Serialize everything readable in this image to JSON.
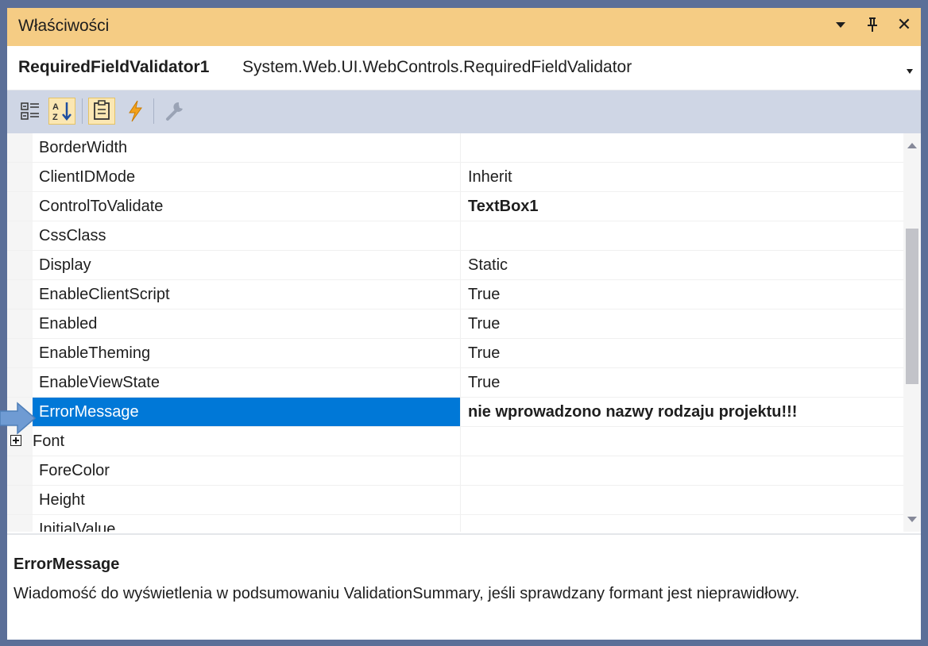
{
  "window": {
    "title": "Właściwości",
    "dropdown_icon": "caret-down-icon",
    "pin_icon": "pin-icon",
    "close_glyph": "✕"
  },
  "object_selector": {
    "name": "RequiredFieldValidator1",
    "type": "System.Web.UI.WebControls.RequiredFieldValidator"
  },
  "toolbar": {
    "buttons": [
      {
        "name": "categorized-icon",
        "active": false
      },
      {
        "name": "alphabetical-icon",
        "active": true
      },
      {
        "name": "properties-icon",
        "active": true
      },
      {
        "name": "events-icon",
        "active": false
      },
      {
        "name": "property-pages-icon",
        "active": false
      }
    ]
  },
  "properties": [
    {
      "name": "BorderWidth",
      "value": ""
    },
    {
      "name": "ClientIDMode",
      "value": "Inherit"
    },
    {
      "name": "ControlToValidate",
      "value": "TextBox1",
      "bold": true
    },
    {
      "name": "CssClass",
      "value": ""
    },
    {
      "name": "Display",
      "value": "Static"
    },
    {
      "name": "EnableClientScript",
      "value": "True"
    },
    {
      "name": "Enabled",
      "value": "True"
    },
    {
      "name": "EnableTheming",
      "value": "True"
    },
    {
      "name": "EnableViewState",
      "value": "True"
    },
    {
      "name": "ErrorMessage",
      "value": "nie wprowadzono nazwy rodzaju projektu!!!",
      "bold": true,
      "selected": true
    },
    {
      "name": "Font",
      "value": "",
      "expandable": true
    },
    {
      "name": "ForeColor",
      "value": ""
    },
    {
      "name": "Height",
      "value": ""
    },
    {
      "name": "InitialValue",
      "value": ""
    }
  ],
  "description": {
    "title": "ErrorMessage",
    "text": "Wiadomość do wyświetlenia w podsumowaniu ValidationSummary, jeśli sprawdzany formant jest nieprawidłowy."
  },
  "colors": {
    "titlebar": "#f5cc84",
    "toolbar": "#cfd6e5",
    "selection": "#0078d7",
    "frame": "#5b6f98",
    "arrow": "#6f9bd3"
  }
}
